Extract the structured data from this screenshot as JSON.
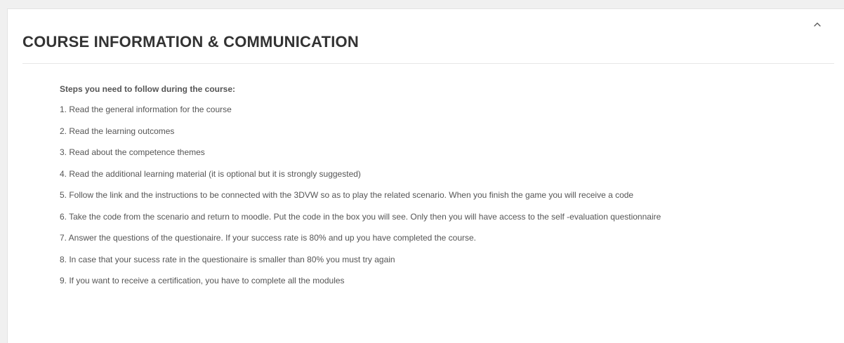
{
  "section": {
    "title": "COURSE INFORMATION & COMMUNICATION",
    "toggle_icon": "chevron-up-icon",
    "steps_heading": "Steps you need to follow during the course:",
    "steps": [
      "1. Read the general information for the course",
      "2. Read the learning outcomes",
      "3. Read about the competence themes",
      "4. Read the additional learning material (it is optional but it is strongly suggested)",
      "5. Follow the link and the instructions to be connected with the 3DVW so as to play the related scenario.  When you finish the game you will receive a code",
      "6. Take the code from the scenario and return to moodle. Put the code in the box you will see. Only then you will have access to the self -evaluation questionnaire",
      "7. Answer the questions of the questionaire. If your success rate is 80% and up you have completed the course.",
      "8. In case that your sucess rate in the questionaire is smaller than 80% you must try again",
      "9. If you want to receive a certification, you have to complete all the modules"
    ]
  },
  "colors": {
    "page_background": "#f0f0f0",
    "card_background": "#ffffff",
    "title_text": "#333333",
    "body_text": "#555555",
    "divider": "#e6e6e6"
  }
}
